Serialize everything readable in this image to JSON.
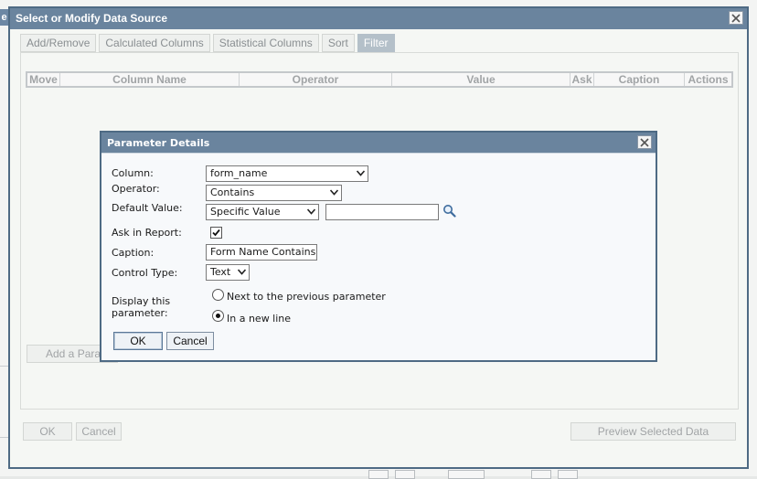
{
  "dialog": {
    "title": "Select or Modify Data Source",
    "tabs": [
      {
        "label": "Add/Remove",
        "active": false
      },
      {
        "label": "Calculated Columns",
        "active": false
      },
      {
        "label": "Statistical Columns",
        "active": false
      },
      {
        "label": "Sort",
        "active": false
      },
      {
        "label": "Filter",
        "active": true
      }
    ],
    "grid_columns": [
      "Move",
      "Column Name",
      "Operator",
      "Value",
      "Ask",
      "Caption",
      "Actions"
    ],
    "add_parameter_label": "Add a Parameter",
    "ok_label": "OK",
    "cancel_label": "Cancel",
    "preview_label": "Preview Selected Data"
  },
  "modal": {
    "title": "Parameter Details",
    "column_label": "Column:",
    "column_value": "form_name",
    "operator_label": "Operator:",
    "operator_value": "Contains",
    "default_value_label": "Default Value:",
    "default_value_type": "Specific Value",
    "default_value_text": "",
    "ask_in_report_label": "Ask in Report:",
    "ask_in_report_checked": true,
    "caption_label": "Caption:",
    "caption_value": "Form Name Contains",
    "control_type_label": "Control Type:",
    "control_type_value": "Text",
    "display_label_line1": "Display this",
    "display_label_line2": "parameter:",
    "display_options": [
      {
        "label": "Next to the previous parameter",
        "checked": false
      },
      {
        "label": "In a new line",
        "checked": true
      }
    ],
    "ok_label": "OK",
    "cancel_label": "Cancel"
  },
  "background": {
    "edge_letter": "e"
  },
  "icons": {
    "close": "close-icon",
    "search": "search-icon",
    "dropdown": "chevron-down-icon",
    "check": "checkmark-icon"
  }
}
